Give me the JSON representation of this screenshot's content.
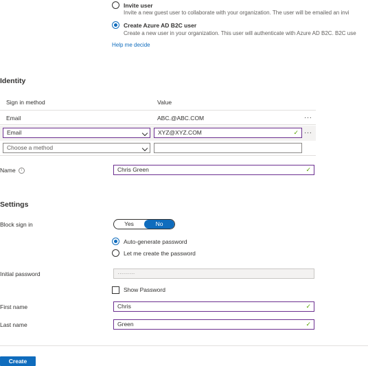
{
  "user_type": {
    "invite": {
      "title": "Invite user",
      "description": "Invite a new guest user to collaborate with your organization. The user will be emailed an invi"
    },
    "create_b2c": {
      "title": "Create Azure AD B2C user",
      "description": "Create a new user in your organization. This user will authenticate with Azure AD B2C. B2C use"
    },
    "help_link": "Help me decide",
    "selected": "create_b2c"
  },
  "identity": {
    "heading": "Identity",
    "columns": {
      "method": "Sign in method",
      "value": "Value"
    },
    "existing_row": {
      "method": "Email",
      "value": "ABC.@ABC.COM",
      "more": "···"
    },
    "edit_row": {
      "method": "Email",
      "value": "XYZ@XYZ.COM",
      "more": "···"
    },
    "new_row": {
      "method_placeholder": "Choose a method",
      "value": ""
    }
  },
  "name": {
    "label": "Name",
    "info": "i",
    "value": "Chris Green"
  },
  "settings": {
    "heading": "Settings",
    "block_sign_in": {
      "label": "Block sign in",
      "yes": "Yes",
      "no": "No",
      "selected": "No"
    },
    "password_options": {
      "auto": "Auto-generate password",
      "manual": "Let me create the password",
      "selected": "auto"
    },
    "initial_password": {
      "label": "Initial password",
      "value": "·········"
    },
    "show_password": {
      "label": "Show Password",
      "checked": false
    },
    "first_name": {
      "label": "First name",
      "value": "Chris"
    },
    "last_name": {
      "label": "Last name",
      "value": "Green"
    }
  },
  "actions": {
    "create": "Create"
  },
  "colors": {
    "accent": "#0f6cbd",
    "valid_border": "#6b2e8f",
    "valid_check": "#57a300"
  }
}
